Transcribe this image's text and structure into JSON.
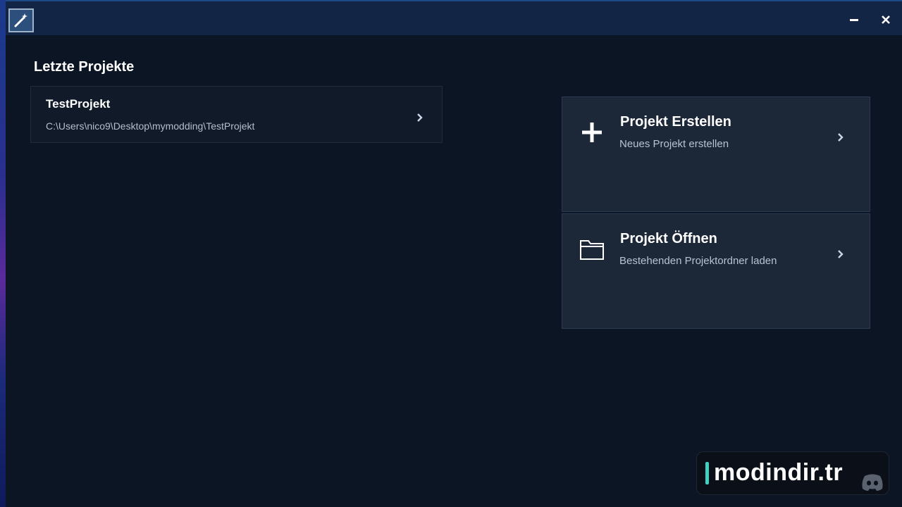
{
  "window": {
    "minimize_icon": "minimize-icon",
    "close_icon": "close-icon",
    "app_icon": "magic-wand-icon"
  },
  "recent": {
    "title": "Letzte Projekte",
    "items": [
      {
        "name": "TestProjekt",
        "path": "C:\\Users\\nico9\\Desktop\\mymodding\\TestProjekt",
        "icon": "chevron-right-icon"
      }
    ]
  },
  "actions": {
    "create": {
      "title": "Projekt Erstellen",
      "subtitle": "Neues Projekt erstellen",
      "icon": "plus-icon"
    },
    "open": {
      "title": "Projekt Öffnen",
      "subtitle": "Bestehenden Projektordner laden",
      "icon": "folder-icon"
    }
  },
  "watermark": {
    "text": "modindir.tr",
    "icon": "discord-icon"
  },
  "colors": {
    "background": "#0c1524",
    "titlebar": "#122544",
    "card": "#1c2738",
    "accent": "#3fd0c0"
  }
}
